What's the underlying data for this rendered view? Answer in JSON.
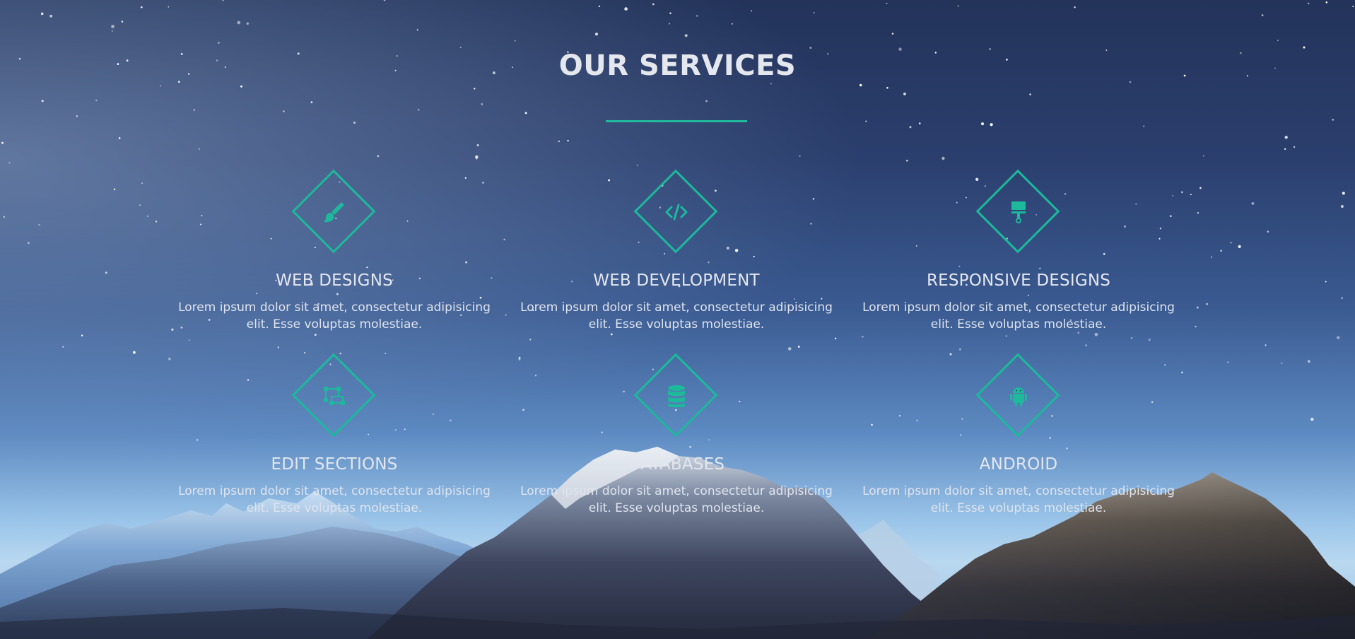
{
  "section": {
    "title": "OUR SERVICES",
    "accent_color": "#1db99b"
  },
  "services": [
    {
      "icon": "paintbrush-icon",
      "title": "WEB DESIGNS",
      "description": "Lorem ipsum dolor sit amet, consectetur adipisicing elit. Esse voluptas molestiae."
    },
    {
      "icon": "code-icon",
      "title": "WEB DEVELOPMENT",
      "description": "Lorem ipsum dolor sit amet, consectetur adipisicing elit. Esse voluptas molestiae."
    },
    {
      "icon": "paint-roller-icon",
      "title": "RESPONSIVE DESIGNS",
      "description": "Lorem ipsum dolor sit amet, consectetur adipisicing elit. Esse voluptas molestiae."
    },
    {
      "icon": "object-ungroup-icon",
      "title": "EDIT SECTIONS",
      "description": "Lorem ipsum dolor sit amet, consectetur adipisicing elit. Esse voluptas molestiae."
    },
    {
      "icon": "database-icon",
      "title": "DATABASES",
      "description": "Lorem ipsum dolor sit amet, consectetur adipisicing elit. Esse voluptas molestiae."
    },
    {
      "icon": "android-icon",
      "title": "ANDROID",
      "description": "Lorem ipsum dolor sit amet, consectetur adipisicing elit. Esse voluptas molestiae."
    }
  ]
}
